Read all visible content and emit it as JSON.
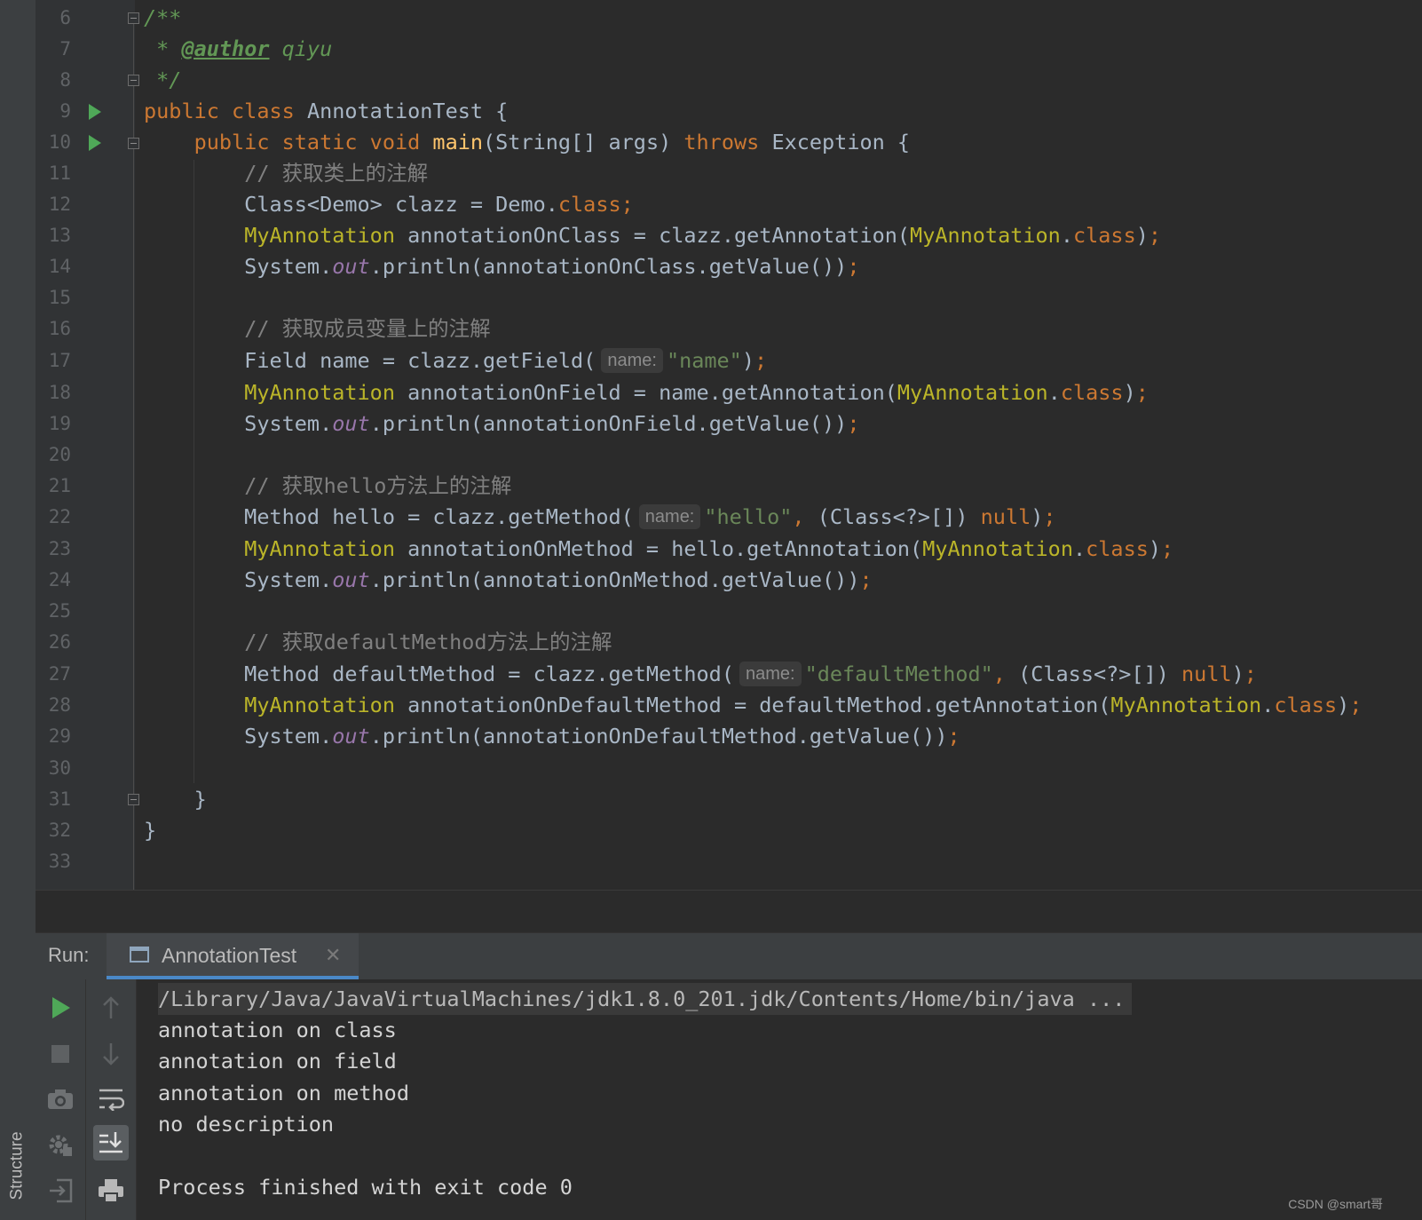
{
  "sidebar": {
    "structure_label": "Structure"
  },
  "editor": {
    "line_numbers": [
      "6",
      "7",
      "8",
      "9",
      "10",
      "11",
      "12",
      "13",
      "14",
      "15",
      "16",
      "17",
      "18",
      "19",
      "20",
      "21",
      "22",
      "23",
      "24",
      "25",
      "26",
      "27",
      "28",
      "29",
      "30",
      "31",
      "32",
      "33"
    ],
    "comments": {
      "class_anno": "// 获取类上的注解",
      "field_anno": "// 获取成员变量上的注解",
      "hello_anno": "// 获取hello方法上的注解",
      "default_anno": "// 获取defaultMethod方法上的注解"
    },
    "javadoc": {
      "open": "/**",
      "author_prefix": " * ",
      "author_tag": "@author",
      "author_name": " qiyu",
      "close": " */"
    },
    "hint_label": "name:",
    "strings": {
      "name": "\"name\"",
      "hello": "\"hello\"",
      "default_method": "\"defaultMethod\""
    }
  },
  "run_panel": {
    "label": "Run:",
    "tab_title": "AnnotationTest",
    "close_glyph": "✕",
    "output": {
      "command": "/Library/Java/JavaVirtualMachines/jdk1.8.0_201.jdk/Contents/Home/bin/java ...",
      "lines": [
        "annotation on class",
        "annotation on field",
        "annotation on method",
        "no description"
      ],
      "exit": "Process finished with exit code 0"
    },
    "toolbar_icons": [
      "run-icon",
      "stop-icon",
      "camera-icon",
      "debug-settings-icon",
      "exit-icon",
      "up-arrow-icon",
      "down-arrow-icon",
      "soft-wrap-icon",
      "scroll-to-end-icon",
      "print-icon"
    ]
  },
  "watermark": "CSDN @smart哥",
  "colors": {
    "keyword": "#cc7832",
    "annotation": "#bbb529",
    "string": "#6a8759",
    "comment": "#808080",
    "static_field": "#9876aa",
    "method_decl": "#ffc66d",
    "run_green": "#4fa858"
  }
}
